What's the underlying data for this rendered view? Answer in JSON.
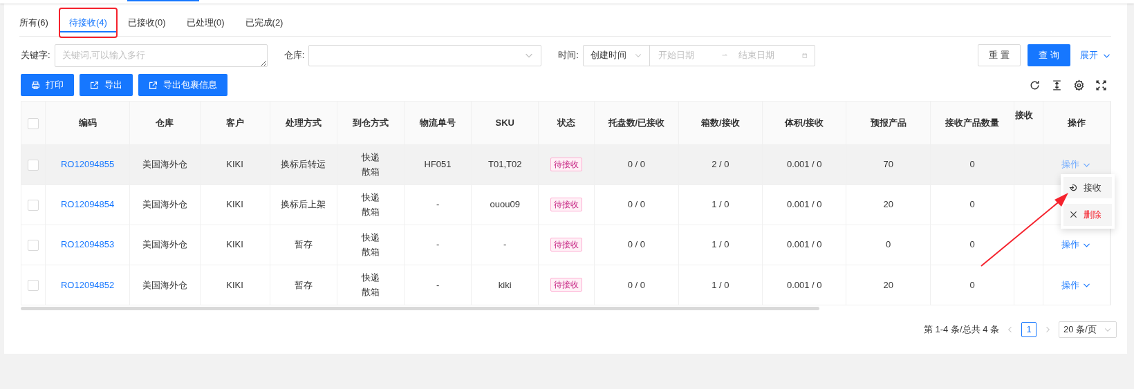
{
  "tabs": [
    {
      "label": "所有(6)",
      "selected": false
    },
    {
      "label": "待接收(4)",
      "selected": true,
      "annotated": true
    },
    {
      "label": "已接收(0)",
      "selected": false
    },
    {
      "label": "已处理(0)",
      "selected": false
    },
    {
      "label": "已完成(2)",
      "selected": false
    }
  ],
  "filters": {
    "keyword": {
      "label": "关键字:",
      "placeholder": "关键词,可以输入多行"
    },
    "warehouse": {
      "label": "仓库:"
    },
    "time": {
      "label": "时间:",
      "type_value": "创建时间",
      "start_placeholder": "开始日期",
      "end_placeholder": "结束日期"
    },
    "reset_button": "重 置",
    "search_button": "查 询",
    "expand_link": "展开"
  },
  "toolbar": [
    {
      "label": "打印",
      "kind": "print"
    },
    {
      "label": "导出",
      "kind": "export"
    },
    {
      "label": "导出包裹信息",
      "kind": "export"
    }
  ],
  "table": {
    "columns": [
      "编码",
      "仓库",
      "客户",
      "处理方式",
      "到仓方式",
      "物流单号",
      "SKU",
      "状态",
      "托盘数/已接收",
      "箱数/接收",
      "体积/接收",
      "预报产品",
      "接收产品数量",
      "接收",
      "操作"
    ],
    "header_checked": false,
    "rows": [
      {
        "checked": false,
        "highlighted": true,
        "code": "RO12094855",
        "warehouse": "美国海外仓",
        "customer": "KIKI",
        "handling": "换标后转运",
        "arrival": [
          "快递",
          "散箱"
        ],
        "tracking": "HF051",
        "sku": "T01,T02",
        "status": "待接收",
        "pallets": "0 / 0",
        "boxes": "2 / 0",
        "volume": "0.001 / 0",
        "forecast": "70",
        "received_qty": "0",
        "action": "操作",
        "menu_open": true
      },
      {
        "checked": false,
        "highlighted": false,
        "code": "RO12094854",
        "warehouse": "美国海外仓",
        "customer": "KIKI",
        "handling": "换标后上架",
        "arrival": [
          "快递",
          "散箱"
        ],
        "tracking": "-",
        "sku": "ouou09",
        "status": "待接收",
        "pallets": "0 / 0",
        "boxes": "1 / 0",
        "volume": "0.001 / 0",
        "forecast": "20",
        "received_qty": "0"
      },
      {
        "checked": false,
        "highlighted": false,
        "code": "RO12094853",
        "warehouse": "美国海外仓",
        "customer": "KIKI",
        "handling": "暂存",
        "arrival": [
          "快递",
          "散箱"
        ],
        "tracking": "-",
        "sku": "-",
        "status": "待接收",
        "pallets": "0 / 0",
        "boxes": "1 / 0",
        "volume": "0.001 / 0",
        "forecast": "0",
        "received_qty": "0",
        "action": "操作",
        "menu_open": false
      },
      {
        "checked": false,
        "highlighted": false,
        "code": "RO12094852",
        "warehouse": "美国海外仓",
        "customer": "KIKI",
        "handling": "暂存",
        "arrival": [
          "快递",
          "散箱"
        ],
        "tracking": "-",
        "sku": "kiki",
        "status": "待接收",
        "pallets": "0 / 0",
        "boxes": "1 / 0",
        "volume": "0.001 / 0",
        "forecast": "20",
        "received_qty": "0",
        "action": "操作",
        "menu_open": false
      }
    ]
  },
  "action_menu": [
    {
      "label": "接收",
      "kind": "receive",
      "danger": false
    },
    {
      "label": "删除",
      "kind": "delete",
      "danger": true
    }
  ],
  "annotation_arrow": true,
  "pagination": {
    "summary": "第 1-4 条/总共 4 条",
    "pages": [
      {
        "label": "1",
        "selected": true
      }
    ],
    "page_size": "20 条/页"
  }
}
